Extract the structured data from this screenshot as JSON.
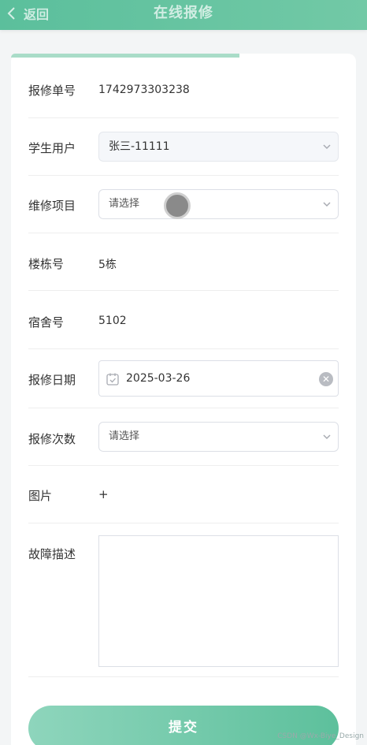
{
  "header": {
    "back_label": "返回",
    "title": "在线报修"
  },
  "form": {
    "order_no": {
      "label": "报修单号",
      "value": "1742973303238"
    },
    "student": {
      "label": "学生用户",
      "value": "张三-11111"
    },
    "repair_item": {
      "label": "维修项目",
      "placeholder": "请选择"
    },
    "building": {
      "label": "楼栋号",
      "value": "5栋"
    },
    "dorm": {
      "label": "宿舍号",
      "value": "5102"
    },
    "repair_date": {
      "label": "报修日期",
      "value": "2025-03-26"
    },
    "repair_count": {
      "label": "报修次数",
      "placeholder": "请选择"
    },
    "image": {
      "label": "图片",
      "value": "+"
    },
    "description": {
      "label": "故障描述",
      "value": ""
    }
  },
  "submit_label": "提交",
  "watermark": "CSDN @Wx-Biye_Design",
  "colors": {
    "accent": "#5dc09c"
  }
}
